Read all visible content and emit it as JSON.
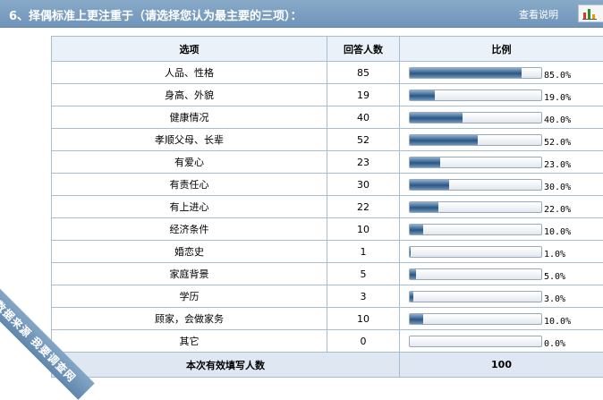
{
  "question": {
    "title": "6、择偶标准上更注重于（请选择您认为最主要的三项）："
  },
  "header": {
    "help_link": "查看说明",
    "chart_icon": "bar-chart-icon"
  },
  "table": {
    "columns": [
      "选项",
      "回答人数",
      "比例"
    ],
    "rows": [
      {
        "option": "人品、性格",
        "count": "85",
        "percent": "85.0%",
        "fraction": 0.85
      },
      {
        "option": "身高、外貌",
        "count": "19",
        "percent": "19.0%",
        "fraction": 0.19
      },
      {
        "option": "健康情况",
        "count": "40",
        "percent": "40.0%",
        "fraction": 0.4
      },
      {
        "option": "孝顺父母、长辈",
        "count": "52",
        "percent": "52.0%",
        "fraction": 0.52
      },
      {
        "option": "有爱心",
        "count": "23",
        "percent": "23.0%",
        "fraction": 0.23
      },
      {
        "option": "有责任心",
        "count": "30",
        "percent": "30.0%",
        "fraction": 0.3
      },
      {
        "option": "有上进心",
        "count": "22",
        "percent": "22.0%",
        "fraction": 0.22
      },
      {
        "option": "经济条件",
        "count": "10",
        "percent": "10.0%",
        "fraction": 0.1
      },
      {
        "option": "婚恋史",
        "count": "1",
        "percent": "1.0%",
        "fraction": 0.01
      },
      {
        "option": "家庭背景",
        "count": "5",
        "percent": "5.0%",
        "fraction": 0.05
      },
      {
        "option": "学历",
        "count": "3",
        "percent": "3.0%",
        "fraction": 0.03
      },
      {
        "option": "顾家，会做家务",
        "count": "10",
        "percent": "10.0%",
        "fraction": 0.1
      },
      {
        "option": "其它",
        "count": "0",
        "percent": "0.0%",
        "fraction": 0.0
      }
    ],
    "total_label": "本次有效填写人数",
    "total_value": "100"
  },
  "watermark": {
    "text": "数据来源 我要调查网"
  },
  "colors": {
    "header_bg": "#7a9dc0",
    "bar_fill": "#3c6791",
    "grid_border": "#a9bdd0"
  }
}
